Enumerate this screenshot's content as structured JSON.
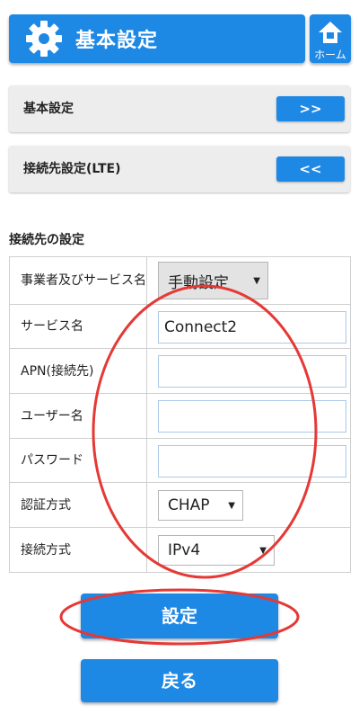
{
  "header": {
    "title": "基本設定",
    "icon": "gear-icon",
    "color": "#1e88e5"
  },
  "home_button": {
    "label": "ホーム",
    "icon": "home-icon"
  },
  "panels": [
    {
      "label": "基本設定",
      "button_label": ">>"
    },
    {
      "label": "接続先設定(LTE)",
      "button_label": "<<"
    }
  ],
  "section_title": "接続先の設定",
  "rows": [
    {
      "label": "事業者及びサービス名",
      "type": "select",
      "value": "手動設定"
    },
    {
      "label": "サービス名",
      "type": "input",
      "value": "Connect2"
    },
    {
      "label": "APN(接続先)",
      "type": "input",
      "value": ""
    },
    {
      "label": "ユーザー名",
      "type": "input",
      "value": ""
    },
    {
      "label": "パスワード",
      "type": "input",
      "value": ""
    },
    {
      "label": "認証方式",
      "type": "select",
      "value": "CHAP"
    },
    {
      "label": "接続方式",
      "type": "select",
      "value": "IPv4"
    }
  ],
  "buttons": {
    "submit": "設定",
    "back": "戻る"
  },
  "annotation_color": "#e53935"
}
